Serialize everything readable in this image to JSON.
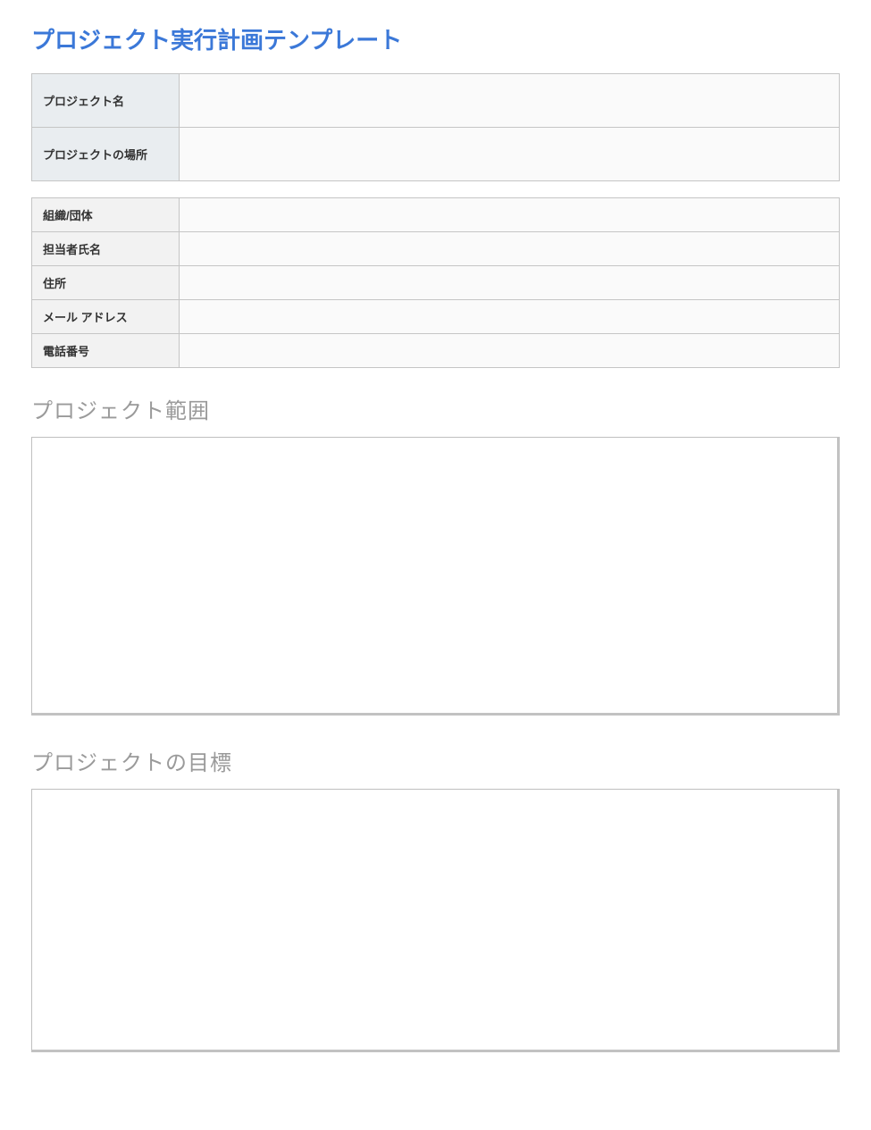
{
  "title": "プロジェクト実行計画テンプレート",
  "primary_table": {
    "rows": [
      {
        "label": "プロジェクト名",
        "value": ""
      },
      {
        "label": "プロジェクトの場所",
        "value": ""
      }
    ]
  },
  "secondary_table": {
    "rows": [
      {
        "label": "組織/団体",
        "value": ""
      },
      {
        "label": "担当者氏名",
        "value": ""
      },
      {
        "label": "住所",
        "value": ""
      },
      {
        "label": "メール アドレス",
        "value": ""
      },
      {
        "label": "電話番号",
        "value": ""
      }
    ]
  },
  "sections": {
    "scope": {
      "heading": "プロジェクト範囲",
      "content": ""
    },
    "goals": {
      "heading": "プロジェクトの目標",
      "content": ""
    }
  }
}
